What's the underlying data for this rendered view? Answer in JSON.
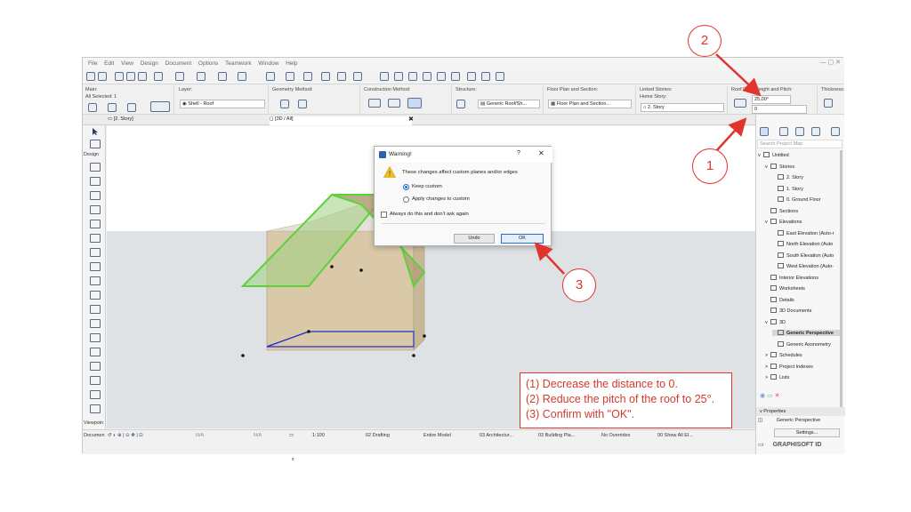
{
  "menu": [
    "File",
    "Edit",
    "View",
    "Design",
    "Document",
    "Options",
    "Teamwork",
    "Window",
    "Help"
  ],
  "window_controls": "— ▢ ✕",
  "infobox": {
    "main_label": "Main:",
    "all_selected": "All Selected: 1",
    "layer_label": "Layer:",
    "layer_value": "Shell - Roof",
    "geometry_label": "Geometry Method:",
    "construction_label": "Construction Method:",
    "structure_label": "Structure:",
    "structure_value": "Generic Roof/Sh...",
    "floorplan_label": "Floor Plan and Section:",
    "floorplan_value": "Floor Plan and Section...",
    "linked_label": "Linked Stories:",
    "home_story_label": "Home Story:",
    "home_story_value": "2. Story",
    "roof_label": "Roof Pivot Height and Pitch:",
    "pitch_value": "25,00°",
    "height_value": "0",
    "thickness_label": "Thickness:"
  },
  "tabs": {
    "story_tab": "[2. Story]",
    "view3d_tab": "[3D / All]"
  },
  "left_toolbox": {
    "design_label": "Design",
    "viewpoint_label": "Viewpoin",
    "document_label": "Documen"
  },
  "navigator": {
    "search_placeholder": "Search Project Map",
    "items": [
      {
        "label": "Untitled",
        "level": 0,
        "expander": "v"
      },
      {
        "label": "Stories",
        "level": 1,
        "expander": "v"
      },
      {
        "label": "2. Story",
        "level": 2,
        "expander": ""
      },
      {
        "label": "1. Story",
        "level": 2,
        "expander": ""
      },
      {
        "label": "0. Ground Floor",
        "level": 2,
        "expander": ""
      },
      {
        "label": "Sections",
        "level": 1,
        "expander": ""
      },
      {
        "label": "Elevations",
        "level": 1,
        "expander": "v"
      },
      {
        "label": "East Elevation (Auto-r",
        "level": 2,
        "expander": ""
      },
      {
        "label": "North Elevation (Auto",
        "level": 2,
        "expander": ""
      },
      {
        "label": "South Elevation (Auto",
        "level": 2,
        "expander": ""
      },
      {
        "label": "West Elevation (Auto-",
        "level": 2,
        "expander": ""
      },
      {
        "label": "Interior Elevations",
        "level": 1,
        "expander": ""
      },
      {
        "label": "Worksheets",
        "level": 1,
        "expander": ""
      },
      {
        "label": "Details",
        "level": 1,
        "expander": ""
      },
      {
        "label": "3D Documents",
        "level": 1,
        "expander": ""
      },
      {
        "label": "3D",
        "level": 1,
        "expander": "v"
      },
      {
        "label": "Generic Perspective",
        "level": 2,
        "expander": "",
        "selected": true
      },
      {
        "label": "Generic Axonometry",
        "level": 2,
        "expander": ""
      },
      {
        "label": "Schedules",
        "level": 1,
        "expander": ">"
      },
      {
        "label": "Project Indexes",
        "level": 1,
        "expander": ">"
      },
      {
        "label": "Lists",
        "level": 1,
        "expander": ">"
      }
    ],
    "properties_label": "Properties",
    "properties_value": "Generic Perspective",
    "settings_button": "Settings...",
    "brand": "GRAPHISOFT ID"
  },
  "statusbar": {
    "na1": "N/A",
    "na2": "N/A",
    "scale": "1:100",
    "drafting": "02 Drafting",
    "model": "Entire Model",
    "architecture": "03 Architectur...",
    "building": "03 Building Pla...",
    "overrides": "No Overrides",
    "show_all": "00 Show All El..."
  },
  "dialog": {
    "title": "Warning!",
    "help": "?",
    "close": "✕",
    "message": "These changes affect custom planes and/or edges",
    "option_keep": "Keep custom",
    "option_apply": "Apply changes to custom",
    "checkbox": "Always do this and don't ask again",
    "undo_button": "Undo",
    "ok_button": "OK"
  },
  "annotations": {
    "callout_1": "1",
    "callout_2": "2",
    "callout_3": "3",
    "note_line1": "(1) Decrease the distance to 0.",
    "note_line2": "(2) Reduce the pitch of the roof to 25°.",
    "note_line3": "(3) Confirm with \"OK\"."
  },
  "colors": {
    "accent": "#1e6fd9",
    "annotation_red": "#e0342f",
    "roof_green": "#5cd23a",
    "wall_tan": "#d9c9a8",
    "selection_blue": "#2233cc"
  }
}
